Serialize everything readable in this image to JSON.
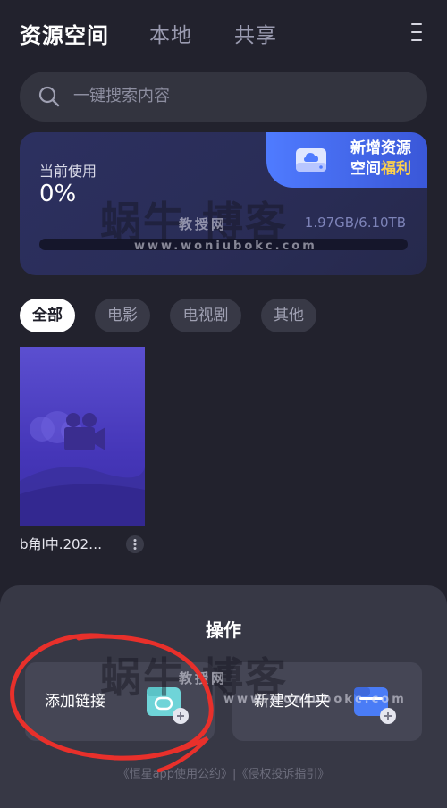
{
  "header": {
    "tabs": [
      {
        "label": "资源空间",
        "active": true
      },
      {
        "label": "本地",
        "active": false
      },
      {
        "label": "共享",
        "active": false
      }
    ],
    "menu_icon": "more-vertical-icon"
  },
  "search": {
    "placeholder": "一键搜索内容",
    "icon": "search-icon"
  },
  "storage": {
    "usage_label": "当前使用",
    "usage_percent": "0%",
    "usage_fraction": 0,
    "usage_amount": "1.97GB/6.10TB",
    "promo": {
      "line1": "新增资源",
      "line2_prefix": "空间",
      "line2_highlight": "福利",
      "icon": "cloud-storage-icon"
    }
  },
  "watermark": {
    "title": "蜗牛 博客",
    "tag": "教授网",
    "url": "www.woniubokc.com"
  },
  "filters": [
    {
      "label": "全部",
      "active": true
    },
    {
      "label": "电影",
      "active": false
    },
    {
      "label": "电视剧",
      "active": false
    },
    {
      "label": "其他",
      "active": false
    }
  ],
  "files": [
    {
      "name": "b角l中.202…",
      "thumb_icon": "video-camera-icon",
      "more_icon": "more-vertical-icon"
    }
  ],
  "sheet": {
    "title": "操作",
    "actions": [
      {
        "label": "添加链接",
        "icon": "add-link-folder-icon"
      },
      {
        "label": "新建文件夹",
        "icon": "new-folder-icon"
      }
    ],
    "footer": "《恒星app使用公约》|《侵权投诉指引》"
  },
  "colors": {
    "background": "#22222d",
    "accent_blue": "#4f7bff",
    "promo_highlight": "#ffd24a",
    "annotation_red": "#e8302b"
  }
}
